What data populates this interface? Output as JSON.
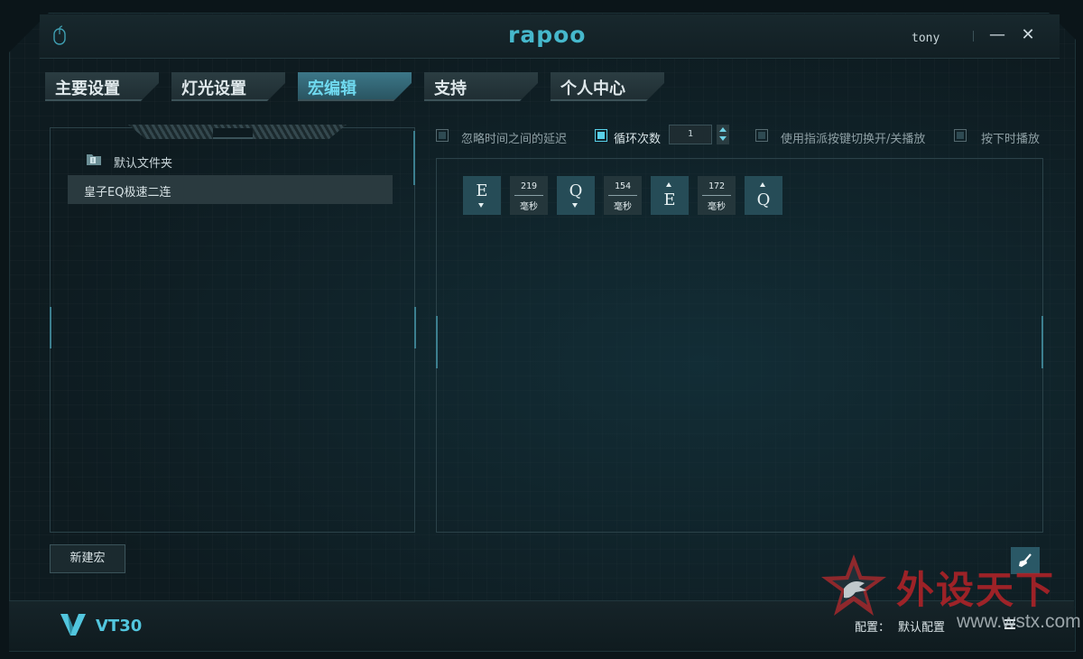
{
  "app": {
    "logo": "rapoo",
    "username": "tony"
  },
  "window": {
    "minimize": "—",
    "close": "✕"
  },
  "tabs": [
    {
      "label": "主要设置"
    },
    {
      "label": "灯光设置"
    },
    {
      "label": "宏编辑",
      "active": true
    },
    {
      "label": "支持"
    },
    {
      "label": "个人中心"
    }
  ],
  "macro_list": {
    "folder_label": "默认文件夹",
    "items": [
      {
        "label": "皇子EQ极速二连",
        "selected": true
      }
    ],
    "new_button": "新建宏"
  },
  "options": {
    "ignore_delay": {
      "label": "忽略时间之间的延迟",
      "checked": false
    },
    "loop": {
      "label": "循环次数",
      "checked": true,
      "value": "1"
    },
    "toggle": {
      "label": "使用指派按键切换开/关播放",
      "checked": false
    },
    "hold": {
      "label": "按下时播放",
      "checked": false
    }
  },
  "macro_events": [
    {
      "type": "key",
      "key": "E",
      "dir": "down"
    },
    {
      "type": "delay",
      "value": "219",
      "unit": "毫秒"
    },
    {
      "type": "key",
      "key": "Q",
      "dir": "down"
    },
    {
      "type": "delay",
      "value": "154",
      "unit": "毫秒"
    },
    {
      "type": "key",
      "key": "E",
      "dir": "up"
    },
    {
      "type": "delay",
      "value": "172",
      "unit": "毫秒"
    },
    {
      "type": "key",
      "key": "Q",
      "dir": "up"
    }
  ],
  "footer": {
    "model": "VT30",
    "config_label": "配置：",
    "config_value": "默认配置"
  },
  "watermark": {
    "text": "外设天下",
    "url": "www.wstx.com"
  },
  "colors": {
    "accent": "#52c6de",
    "active_tab": "#3c7788",
    "key_bg": "#264c57"
  }
}
